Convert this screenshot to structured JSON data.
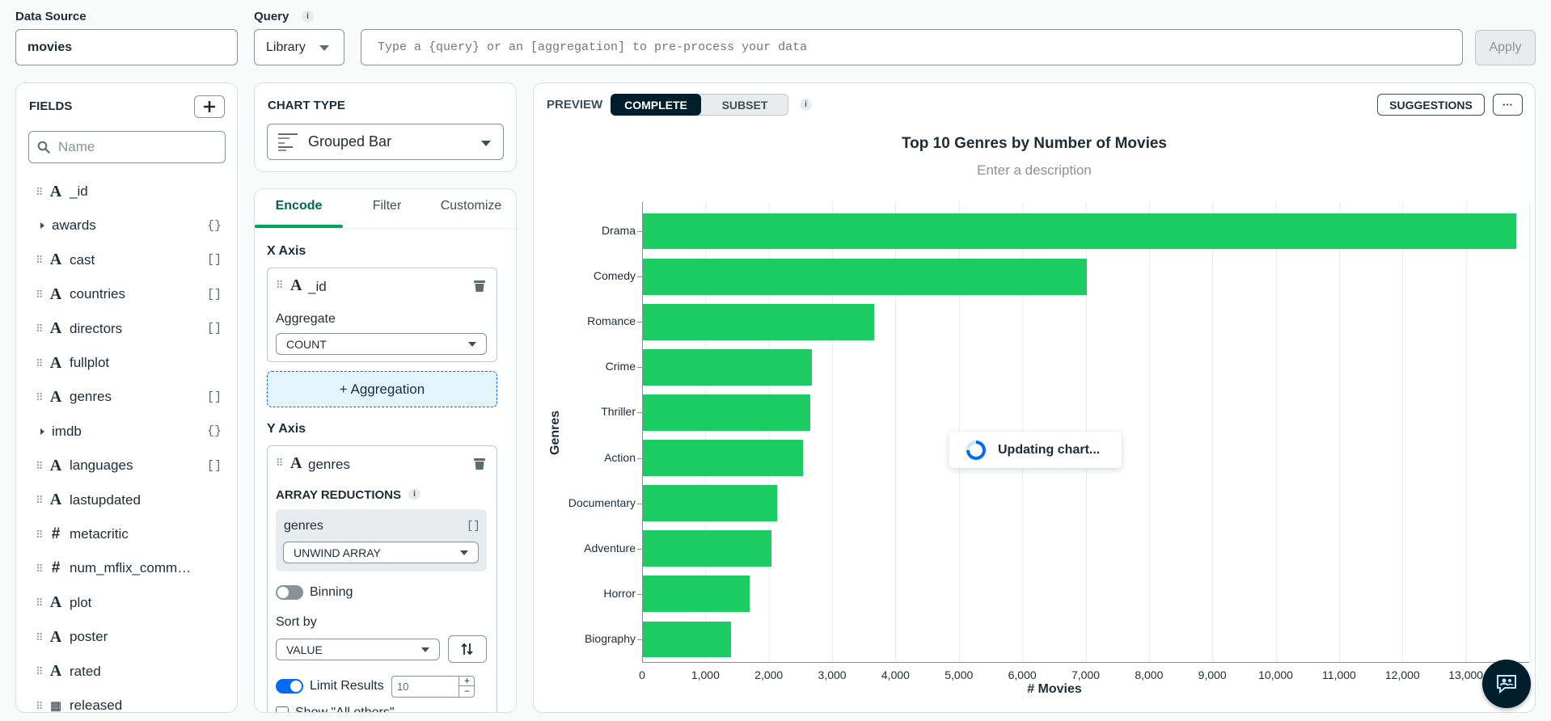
{
  "data_source": {
    "label": "Data Source",
    "value": "movies"
  },
  "query": {
    "label": "Query",
    "library_label": "Library",
    "placeholder": "Type a {query} or an [aggregation] to pre-process your data",
    "apply_label": "Apply"
  },
  "fields": {
    "title": "FIELDS",
    "search_placeholder": "Name",
    "items": [
      {
        "name": "_id",
        "type": "string",
        "badge": ""
      },
      {
        "name": "awards",
        "type": "object",
        "badge": "{}"
      },
      {
        "name": "cast",
        "type": "string",
        "badge": "[]"
      },
      {
        "name": "countries",
        "type": "string",
        "badge": "[]"
      },
      {
        "name": "directors",
        "type": "string",
        "badge": "[]"
      },
      {
        "name": "fullplot",
        "type": "string",
        "badge": ""
      },
      {
        "name": "genres",
        "type": "string",
        "badge": "[]"
      },
      {
        "name": "imdb",
        "type": "object",
        "badge": "{}"
      },
      {
        "name": "languages",
        "type": "string",
        "badge": "[]"
      },
      {
        "name": "lastupdated",
        "type": "string",
        "badge": ""
      },
      {
        "name": "metacritic",
        "type": "number",
        "badge": ""
      },
      {
        "name": "num_mflix_comments",
        "type": "number",
        "badge": ""
      },
      {
        "name": "plot",
        "type": "string",
        "badge": ""
      },
      {
        "name": "poster",
        "type": "string",
        "badge": ""
      },
      {
        "name": "rated",
        "type": "string",
        "badge": ""
      },
      {
        "name": "released",
        "type": "date",
        "badge": ""
      }
    ]
  },
  "chart_type": {
    "title": "CHART TYPE",
    "value": "Grouped Bar"
  },
  "encode_tabs": {
    "encode": "Encode",
    "filter": "Filter",
    "customize": "Customize"
  },
  "x_axis": {
    "title": "X Axis",
    "field": "_id",
    "aggregate_label": "Aggregate",
    "aggregate_value": "COUNT",
    "add_aggregation": "+ Aggregation"
  },
  "y_axis": {
    "title": "Y Axis",
    "field": "genres",
    "array_reductions_label": "ARRAY REDUCTIONS",
    "reduction_field": "genres",
    "reduction_badge": "[]",
    "reduction_value": "UNWIND ARRAY",
    "binning_label": "Binning",
    "sort_by_label": "Sort by",
    "sort_by_value": "VALUE",
    "limit_label": "Limit Results",
    "limit_value": "10",
    "show_all_others": "Show \"All others\""
  },
  "preview": {
    "label": "PREVIEW",
    "complete": "COMPLETE",
    "subset": "SUBSET",
    "suggestions": "SUGGESTIONS",
    "more": "···",
    "loading": "Updating chart..."
  },
  "colors": {
    "bar": "#1ccb62",
    "accent": "#00684a",
    "toggle_on": "#016bf8",
    "dark": "#001e2b"
  },
  "chart_data": {
    "type": "bar",
    "orientation": "horizontal",
    "title": "Top 10 Genres by Number of Movies",
    "subtitle": "Enter a description",
    "xlabel": "# Movies",
    "ylabel": "Genres",
    "categories": [
      "Drama",
      "Comedy",
      "Romance",
      "Crime",
      "Thriller",
      "Action",
      "Documentary",
      "Adventure",
      "Horror",
      "Biography"
    ],
    "values": [
      13790,
      7024,
      3665,
      2678,
      2658,
      2539,
      2129,
      2045,
      1702,
      1404
    ],
    "xlim": [
      0,
      14000
    ],
    "x_ticks": [
      "0",
      "1,000",
      "2,000",
      "3,000",
      "4,000",
      "5,000",
      "6,000",
      "7,000",
      "8,000",
      "9,000",
      "10,000",
      "11,000",
      "12,000",
      "13,000"
    ],
    "grid": true
  }
}
